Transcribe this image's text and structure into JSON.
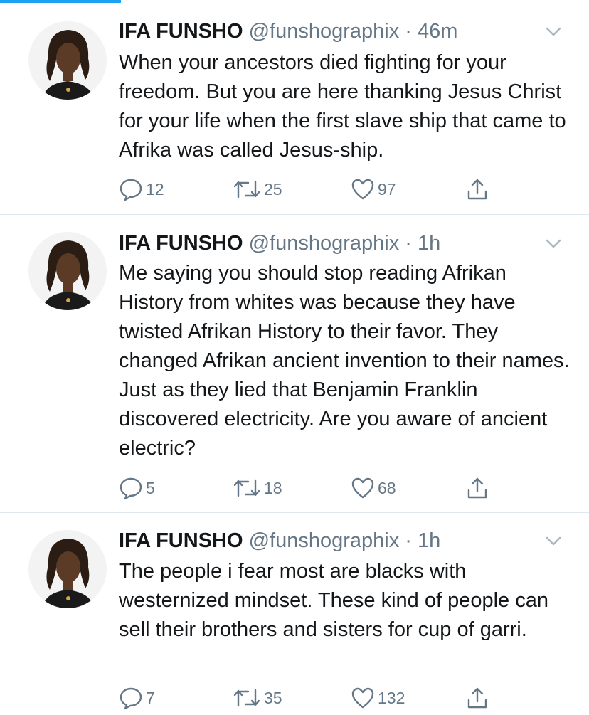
{
  "colors": {
    "accent": "#1da1f2",
    "text": "#14171a",
    "secondary": "#657786",
    "divider": "#e1e8ed"
  },
  "tweets": [
    {
      "name": "IFA FUNSHO",
      "handle": "@funshographix",
      "separator": "·",
      "time": "46m",
      "text": "When your ancestors died fighting for your freedom. But you are here thanking Jesus Christ for your life when the first slave ship that came to Afrika was called Jesus-ship.",
      "replies": "12",
      "retweets": "25",
      "likes": "97"
    },
    {
      "name": "IFA FUNSHO",
      "handle": "@funshographix",
      "separator": "·",
      "time": "1h",
      "text": "Me saying you should stop reading Afrikan History from whites was because they have twisted Afrikan History to their favor. They changed Afrikan ancient invention to their names. Just as they lied that Benjamin Franklin discovered electricity. Are you aware of ancient electric?",
      "replies": "5",
      "retweets": "18",
      "likes": "68"
    },
    {
      "name": "IFA FUNSHO",
      "handle": "@funshographix",
      "separator": "·",
      "time": "1h",
      "text": "The people i fear most are blacks with westernized mindset. These kind of people can sell their brothers and sisters for cup of garri.",
      "replies": "7",
      "retweets": "35",
      "likes": "132"
    }
  ],
  "icons": {
    "reply": "reply-icon",
    "retweet": "retweet-icon",
    "like": "heart-icon",
    "share": "share-icon",
    "menu": "chevron-down-icon"
  }
}
